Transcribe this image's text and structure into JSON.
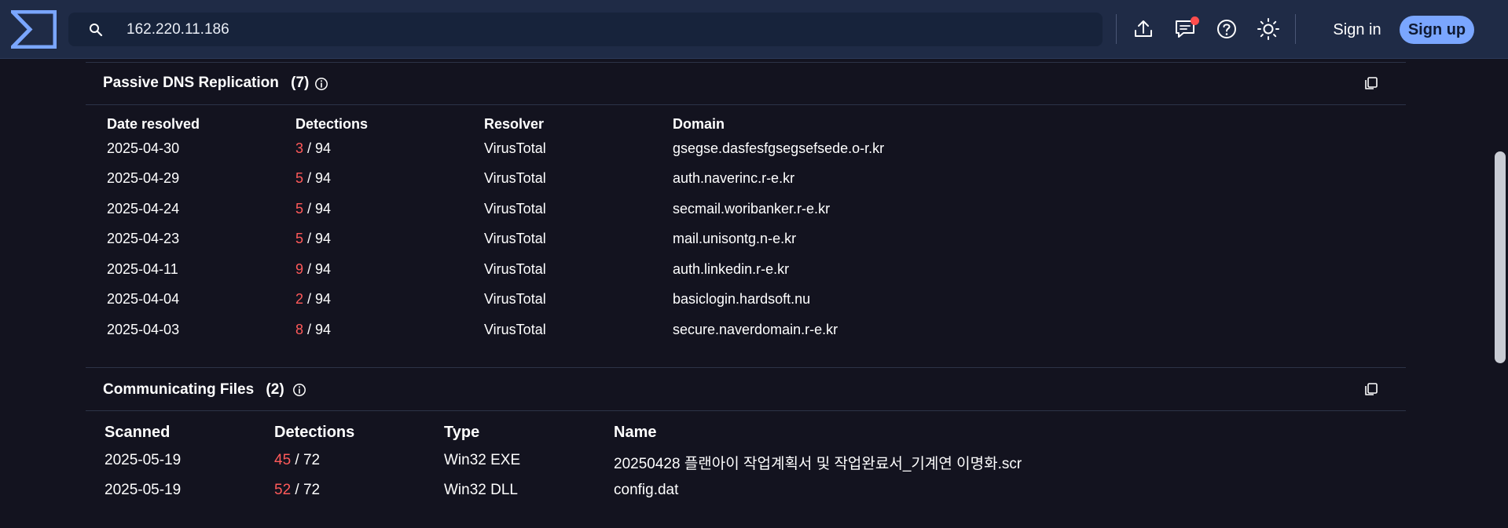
{
  "search": {
    "value": "162.220.11.186"
  },
  "header": {
    "sign_in": "Sign in",
    "sign_up": "Sign up"
  },
  "passive_dns": {
    "title": "Passive DNS Replication",
    "count": "(7)",
    "columns": [
      "Date resolved",
      "Detections",
      "Resolver",
      "Domain"
    ],
    "rows": [
      {
        "date": "2025-04-30",
        "det": "3",
        "total": "/ 94",
        "resolver": "VirusTotal",
        "domain": "gsegse.dasfesfgsegsefsede.o-r.kr"
      },
      {
        "date": "2025-04-29",
        "det": "5",
        "total": "/ 94",
        "resolver": "VirusTotal",
        "domain": "auth.naverinc.r-e.kr"
      },
      {
        "date": "2025-04-24",
        "det": "5",
        "total": "/ 94",
        "resolver": "VirusTotal",
        "domain": "secmail.woribanker.r-e.kr"
      },
      {
        "date": "2025-04-23",
        "det": "5",
        "total": "/ 94",
        "resolver": "VirusTotal",
        "domain": "mail.unisontg.n-e.kr"
      },
      {
        "date": "2025-04-11",
        "det": "9",
        "total": "/ 94",
        "resolver": "VirusTotal",
        "domain": "auth.linkedin.r-e.kr"
      },
      {
        "date": "2025-04-04",
        "det": "2",
        "total": "/ 94",
        "resolver": "VirusTotal",
        "domain": "basiclogin.hardsoft.nu"
      },
      {
        "date": "2025-04-03",
        "det": "8",
        "total": "/ 94",
        "resolver": "VirusTotal",
        "domain": "secure.naverdomain.r-e.kr"
      }
    ]
  },
  "communicating_files": {
    "title": "Communicating Files",
    "count": "(2)",
    "columns": [
      "Scanned",
      "Detections",
      "Type",
      "Name"
    ],
    "rows": [
      {
        "scanned": "2025-05-19",
        "det": "45",
        "total": "/ 72",
        "type": "Win32 EXE",
        "name": "20250428 플랜아이 작업계획서 및 작업완료서_기계연 이명화.scr"
      },
      {
        "scanned": "2025-05-19",
        "det": "52",
        "total": "/ 72",
        "type": "Win32 DLL",
        "name": "config.dat"
      }
    ]
  },
  "colors": {
    "topbar": "#1f2b46",
    "background": "#13131f",
    "accent": "#7aa6ff",
    "detection": "#ff5a5a",
    "notification": "#ff4d4d"
  },
  "icons": {
    "logo": "virustotal-logo-icon",
    "search": "search-icon",
    "upload": "upload-icon",
    "chat": "chat-icon",
    "help": "help-icon",
    "theme": "sun-icon",
    "info": "info-icon",
    "copy": "copy-icon"
  }
}
